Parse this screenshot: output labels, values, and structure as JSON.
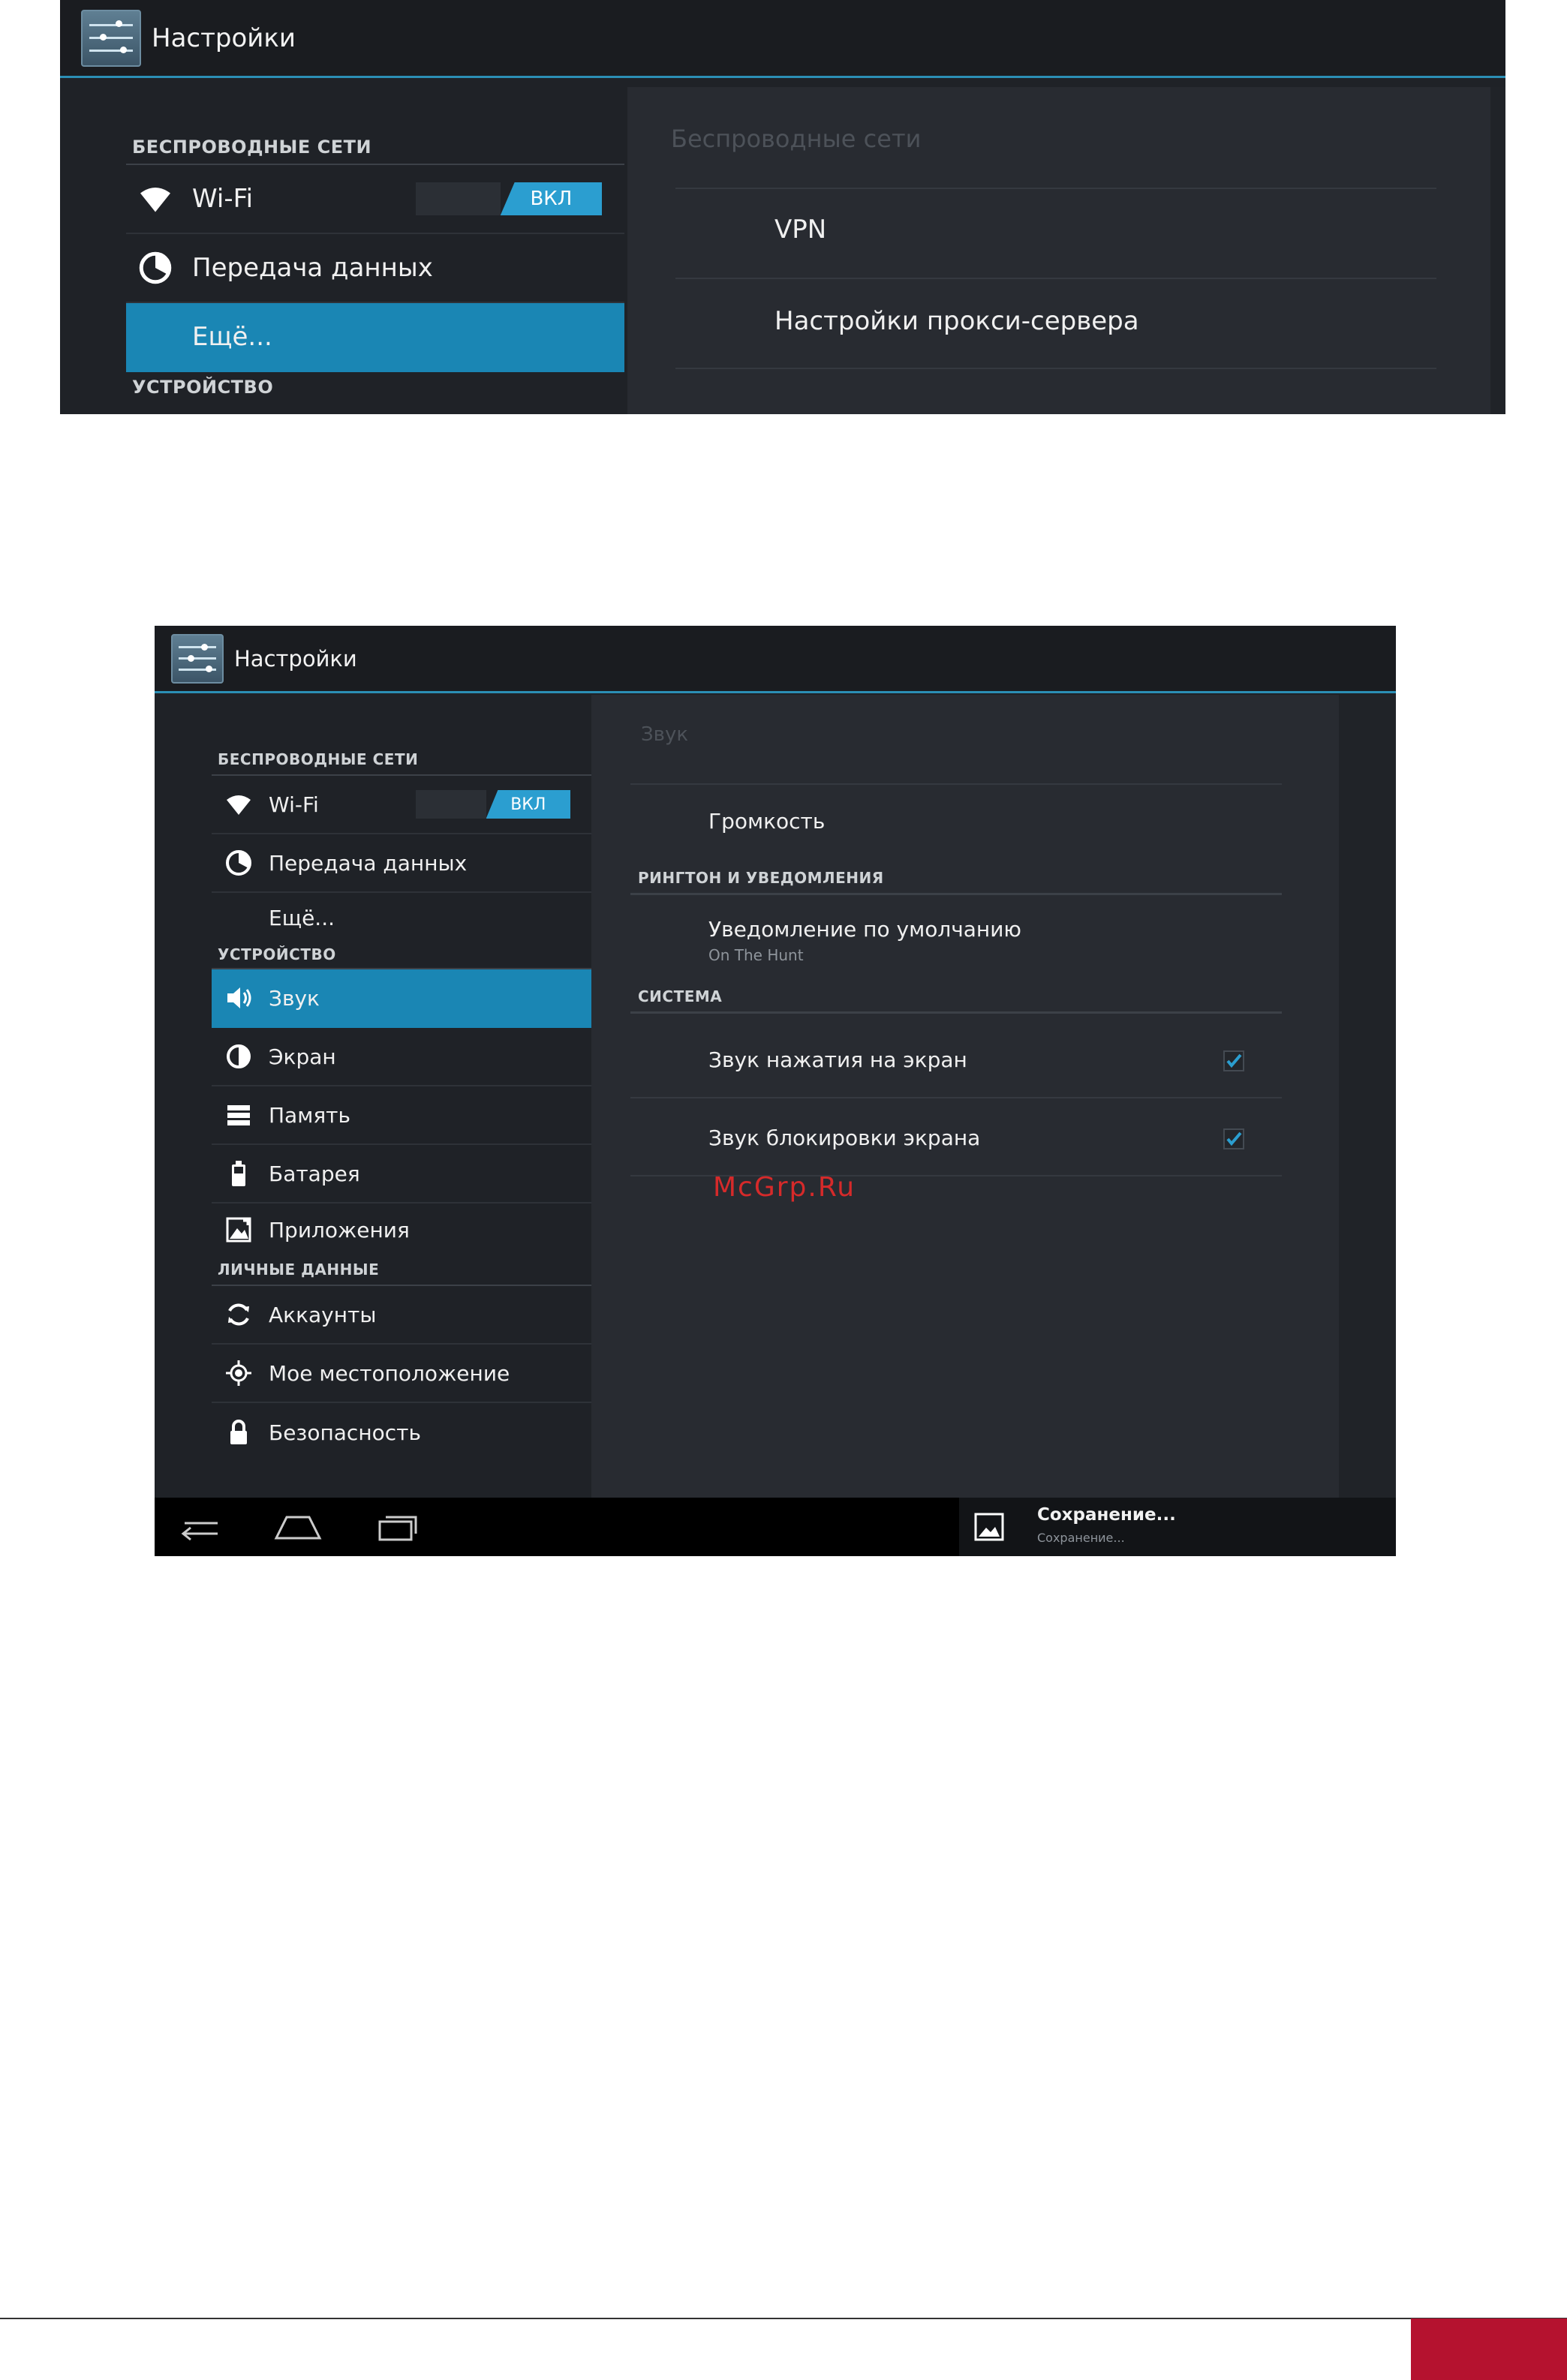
{
  "colors": {
    "accent": "#2b8fb5",
    "selected_bg": "#1a86b4",
    "toggle_on": "#2b9ed0",
    "watermark": "#d62a2a",
    "footer_block": "#b5122f"
  },
  "screen1": {
    "app_title": "Настройки",
    "left": {
      "category_wireless": "БЕСПРОВОДНЫЕ СЕТИ",
      "wifi_label": "Wi-Fi",
      "wifi_toggle": "ВКЛ",
      "data_label": "Передача данных",
      "more_label": "Ещё...",
      "category_device": "УСТРОЙСТВО"
    },
    "detail": {
      "title": "Беспроводные сети",
      "vpn": "VPN",
      "proxy": "Настройки прокси-сервера"
    }
  },
  "screen2": {
    "app_title": "Настройки",
    "left": {
      "category_wireless": "БЕСПРОВОДНЫЕ СЕТИ",
      "wifi_label": "Wi-Fi",
      "wifi_toggle": "ВКЛ",
      "data_label": "Передача данных",
      "more_label": "Ещё...",
      "category_device": "УСТРОЙСТВО",
      "sound_label": "Звук",
      "screen_label": "Экран",
      "memory_label": "Память",
      "battery_label": "Батарея",
      "apps_label": "Приложения",
      "category_personal": "ЛИЧНЫЕ ДАННЫЕ",
      "accounts_label": "Аккаунты",
      "location_label": "Мое местоположение",
      "security_label": "Безопасность"
    },
    "detail": {
      "title": "Звук",
      "volume": "Громкость",
      "category_ringtone": "РИНГТОН И УВЕДОМЛЕНИЯ",
      "default_notification": "Уведомление по умолчанию",
      "default_notification_value": "On The Hunt",
      "category_system": "СИСТЕМА",
      "touch_sound": "Звук нажатия на экран",
      "touch_sound_checked": true,
      "lock_sound": "Звук блокировки экрана",
      "lock_sound_checked": true
    },
    "statusbar": {
      "notification_title": "Сохранение...",
      "notification_sub": "Сохранение..."
    }
  },
  "watermark": "McGrp.Ru"
}
